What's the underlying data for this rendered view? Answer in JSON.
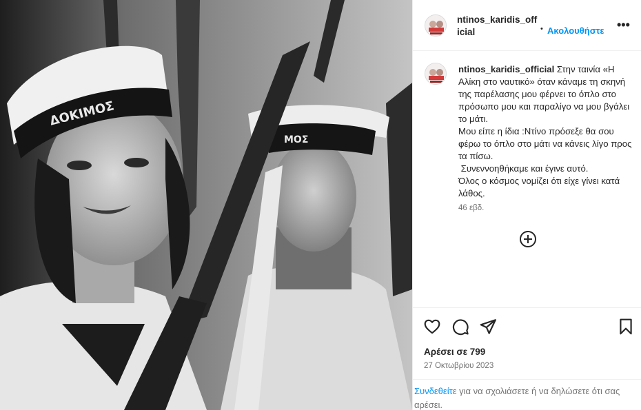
{
  "header": {
    "username": "ntinos_karidis_official",
    "separator": "•",
    "follow_label": "Ακολουθήστε",
    "more_label": "•••"
  },
  "post": {
    "caption_user": "ntinos_karidis_official",
    "caption_text": "Στην ταινία «Η Αλίκη στο ναυτικό» όταν κάναμε τη σκηνή της παρέλασης μου φέρνει το όπλο στο πρόσωπο μου και παραλίγο να μου βγάλει το μάτι.\nΜου είπε η ίδια :Ντίνο πρόσεξε θα σου φέρω το όπλο στο μάτι να κάνεις λίγο προς τα πίσω.\n Συνεννοηθήκαμε και έγινε αυτό.\nΌλος ο κόσμος νομίζει ότι είχε γίνει κατά λάθος.",
    "time_ago": "46 εβδ.",
    "photo_cap_text_left": "ΔΟΚΙΜΟΣ",
    "photo_cap_text_right": "ΜΟΣ"
  },
  "actions": {
    "likes_label": "Αρέσει σε 799",
    "date": "27 Οκτωβρίου 2023"
  },
  "login_note": {
    "link_text": "Συνδεθείτε",
    "rest_text": " για να σχολιάσετε ή να δηλώσετε ότι σας αρέσει."
  },
  "colors": {
    "accent": "#0095f6",
    "text": "#262626",
    "secondary": "#737373",
    "border": "#efefef"
  },
  "icons": [
    "like-icon",
    "comment-icon",
    "share-icon",
    "save-icon",
    "more-icon",
    "load-more-comments-icon"
  ]
}
